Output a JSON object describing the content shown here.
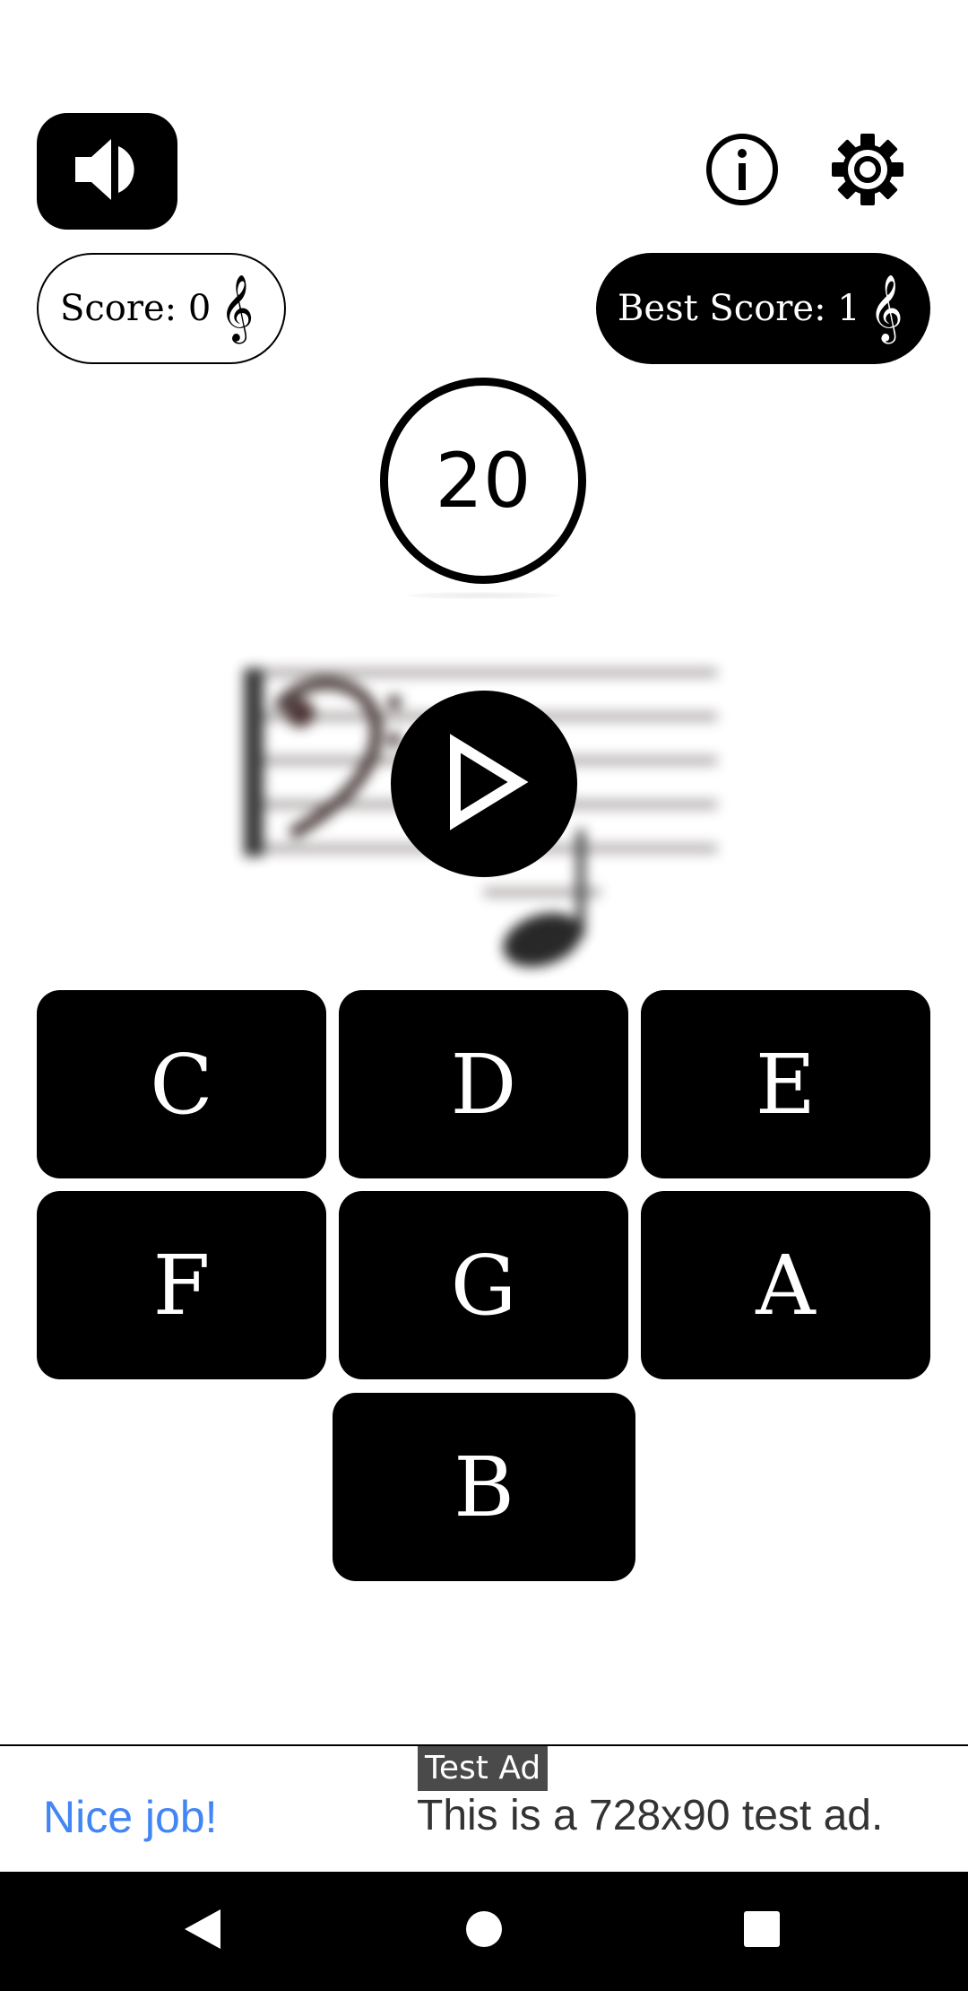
{
  "header": {
    "sound_icon": "speaker-icon",
    "info_icon": "info-icon",
    "settings_icon": "gear-icon"
  },
  "scores": {
    "score_label": "Score: 0",
    "best_label": "Best Score: 1",
    "clef_icon": "treble-clef-icon"
  },
  "timer": {
    "value": "20"
  },
  "question": {
    "clef": "bass-clef",
    "play_icon": "play-icon"
  },
  "notes": [
    "C",
    "D",
    "E",
    "F",
    "G",
    "A",
    "B"
  ],
  "ad": {
    "tag": "Test Ad",
    "left_text": "Nice job!",
    "right_text": "This is a 728x90 test ad."
  },
  "navbar": {
    "back_icon": "back-icon",
    "home_icon": "home-icon",
    "recents_icon": "recents-icon"
  },
  "colors": {
    "primary": "#000000",
    "background": "#ffffff",
    "ad_link": "#4285f4"
  }
}
